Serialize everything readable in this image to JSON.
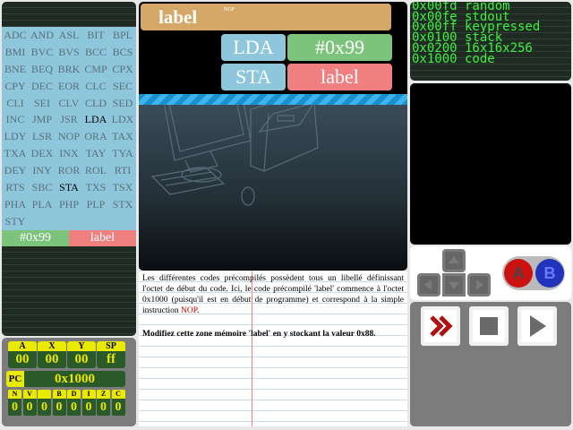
{
  "opcodes": [
    "ADC",
    "AND",
    "ASL",
    "BIT",
    "BPL",
    "BMI",
    "BVC",
    "BVS",
    "BCC",
    "BCS",
    "BNE",
    "BEQ",
    "BRK",
    "CMP",
    "CPX",
    "CPY",
    "DEC",
    "EOR",
    "CLC",
    "SEC",
    "CLI",
    "SEI",
    "CLV",
    "CLD",
    "SED",
    "INC",
    "JMP",
    "JSR",
    "LDA",
    "LDX",
    "LDY",
    "LSR",
    "NOP",
    "ORA",
    "TAX",
    "TXA",
    "DEX",
    "INX",
    "TAY",
    "TYA",
    "DEY",
    "INY",
    "ROR",
    "ROL",
    "RTI",
    "RTS",
    "SBC",
    "STA",
    "TXS",
    "TSX",
    "PHA",
    "PLA",
    "PHP",
    "PLP",
    "STX",
    "STY"
  ],
  "used_opcodes": [
    "LDA",
    "STA"
  ],
  "selection": {
    "value": "#0x99",
    "label": "label"
  },
  "program": {
    "banner_label": "label",
    "banner_note": "NOP",
    "lines": [
      {
        "op": "LDA",
        "arg": "#0x99",
        "arg_color": "green"
      },
      {
        "op": "STA",
        "arg": "label",
        "arg_color": "red"
      }
    ]
  },
  "registers": {
    "a": {
      "label": "A",
      "value": "00"
    },
    "x": {
      "label": "X",
      "value": "00"
    },
    "y": {
      "label": "Y",
      "value": "00"
    },
    "sp": {
      "label": "SP",
      "value": "ff"
    },
    "pc": {
      "label": "PC",
      "value": "0x1000"
    }
  },
  "flags": [
    {
      "label": "N",
      "value": "0"
    },
    {
      "label": "V",
      "value": "0"
    },
    {
      "label": "",
      "value": "0"
    },
    {
      "label": "B",
      "value": "0"
    },
    {
      "label": "D",
      "value": "0"
    },
    {
      "label": "I",
      "value": "0"
    },
    {
      "label": "Z",
      "value": "0"
    },
    {
      "label": "C",
      "value": "0"
    }
  ],
  "description": {
    "p1_before": "Les différentes codes précompilés possèdent tous un libellé définissant l'octet de début du code. Ici, le code précompilé 'label' commence à l'octet 0x1000 (puisqu'il est en début de programme) et correspond à la simple instruction ",
    "p1_highlight": "NOP",
    "p1_after": ".",
    "p2": "Modifiez cette zone mémoire 'label' en y stockant la valeur 0x88."
  },
  "memory_map": [
    "0x00fd random",
    "0x00fe stdout",
    "0x00ff keypressed",
    "0x0100 stack",
    "0x0200 16x16x256",
    "0x1000 code"
  ],
  "gamepad": {
    "a_label": "A",
    "b_label": "B"
  },
  "colors": {
    "opcode_bg": "#8ec6dc",
    "green": "#7cc47c",
    "red": "#f08080",
    "banner": "#d6a868",
    "register_label": "#eaea00",
    "register_value_bg": "#2a5a2a",
    "memory_text": "#3ef03e"
  },
  "icons": {
    "dpad": [
      "up-arrow-icon",
      "left-arrow-icon",
      "down-arrow-icon",
      "right-arrow-icon"
    ],
    "controls": [
      "fast-forward-icon",
      "stop-icon",
      "play-icon"
    ]
  }
}
